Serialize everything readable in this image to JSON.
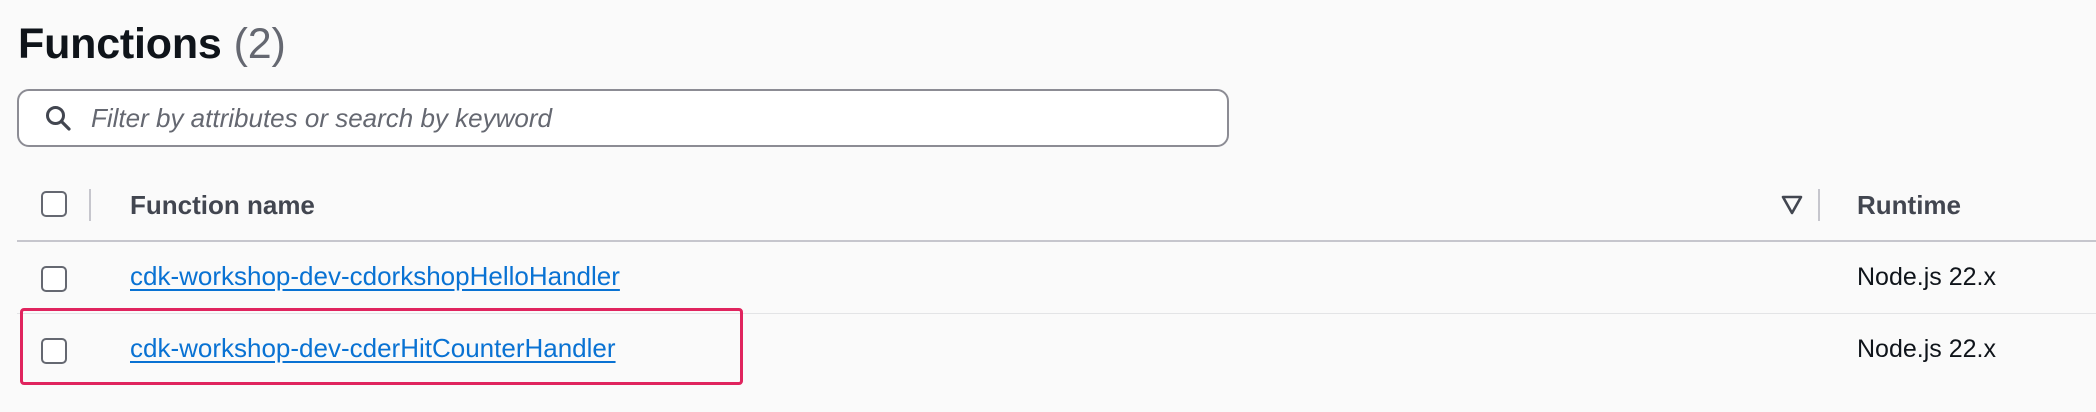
{
  "header": {
    "title": "Functions",
    "count": "(2)"
  },
  "search": {
    "placeholder": "Filter by attributes or search by keyword",
    "icon": "search-icon"
  },
  "table": {
    "columns": {
      "name": "Function name",
      "runtime": "Runtime"
    },
    "rows": [
      {
        "name": "cdk-workshop-dev-cdorkshopHelloHandler",
        "runtime": "Node.js 22.x"
      },
      {
        "name": "cdk-workshop-dev-cderHitCounterHandler",
        "runtime": "Node.js 22.x"
      }
    ]
  },
  "colors": {
    "link": "#0972d3",
    "highlight": "#e0245e",
    "background": "#fafafa"
  }
}
